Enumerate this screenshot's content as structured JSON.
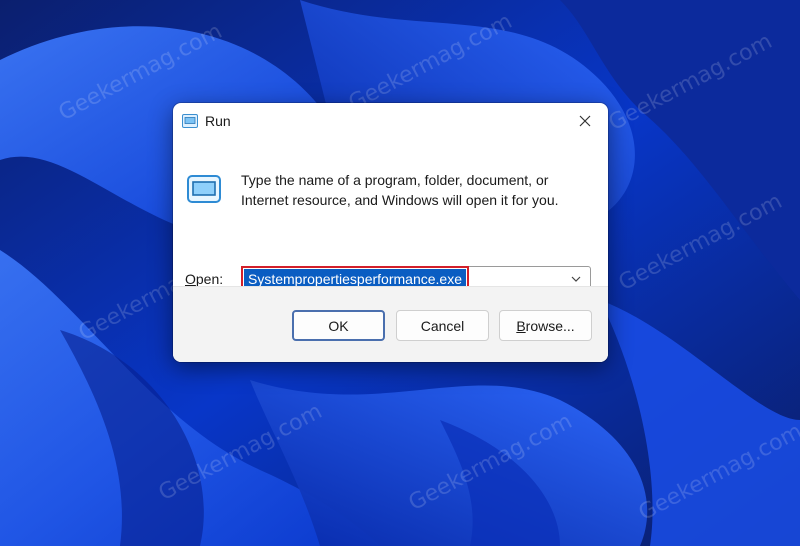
{
  "dialog": {
    "title": "Run",
    "description": "Type the name of a program, folder, document, or Internet resource, and Windows will open it for you.",
    "open_label_first": "O",
    "open_label_rest": "pen:",
    "open_value": "Systempropertiesperformance.exe"
  },
  "buttons": {
    "ok": "OK",
    "cancel": "Cancel",
    "browse_first": "B",
    "browse_rest": "rowse..."
  },
  "watermark": "Geekermag.com",
  "colors": {
    "selection": "#0a5dc2",
    "highlight_box": "#d3202a",
    "wallpaper": "#0a2a8a"
  },
  "icons": {
    "title": "run-app-icon",
    "body": "run-app-icon",
    "close": "close-icon",
    "dropdown": "chevron-down-icon"
  }
}
